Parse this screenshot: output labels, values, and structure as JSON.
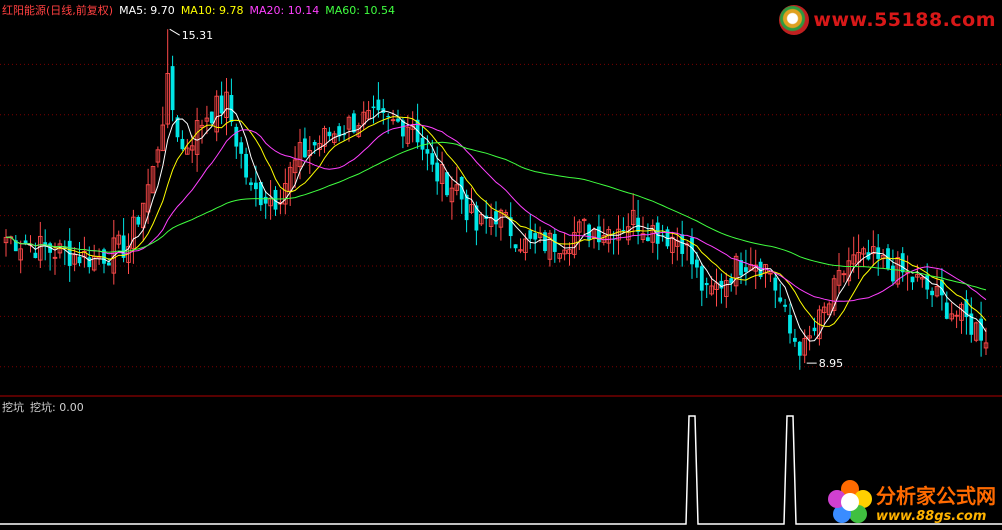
{
  "header": {
    "title": "红阳能源(日线,前复权)",
    "ma5": "MA5: 9.70",
    "ma10": "MA10: 9.78",
    "ma20": "MA20: 10.14",
    "ma60": "MA60: 10.54"
  },
  "sub_header": {
    "label": "挖坑",
    "value": "挖坑: 0.00"
  },
  "logos": {
    "top": "www.55188.com",
    "bottom_line1": "分析家公式网",
    "bottom_line2": "www.88gs.com"
  },
  "colors": {
    "up": "#ff4a4a",
    "down": "#00e5e5",
    "ma5": "#ffffff",
    "ma10": "#ffff00",
    "ma20": "#ff40ff",
    "ma60": "#40ff40",
    "title": "#ff4040",
    "text": "#d0d0d0",
    "grid": "#7a0000",
    "indicator": "#ffffff"
  },
  "chart_data": {
    "type": "candlestick",
    "price_range": [
      8.4,
      15.6
    ],
    "annotations": [
      {
        "label": "15.31",
        "price": 15.31,
        "kind": "high"
      },
      {
        "label": "8.95",
        "price": 8.95,
        "kind": "low"
      }
    ],
    "anchors": [
      {
        "i": 0,
        "p": 11.35
      },
      {
        "i": 9,
        "p": 11.1
      },
      {
        "i": 18,
        "p": 10.95
      },
      {
        "i": 25,
        "p": 11.2
      },
      {
        "i": 30,
        "p": 12.6
      },
      {
        "i": 33,
        "p": 14.2
      },
      {
        "i": 36,
        "p": 13.0
      },
      {
        "i": 41,
        "p": 13.7
      },
      {
        "i": 45,
        "p": 13.9
      },
      {
        "i": 50,
        "p": 12.2
      },
      {
        "i": 55,
        "p": 12.1
      },
      {
        "i": 60,
        "p": 12.9
      },
      {
        "i": 66,
        "p": 13.3
      },
      {
        "i": 72,
        "p": 13.6
      },
      {
        "i": 78,
        "p": 13.5
      },
      {
        "i": 83,
        "p": 13.55
      },
      {
        "i": 87,
        "p": 12.6
      },
      {
        "i": 92,
        "p": 12.3
      },
      {
        "i": 96,
        "p": 11.5
      },
      {
        "i": 100,
        "p": 11.8
      },
      {
        "i": 106,
        "p": 11.2
      },
      {
        "i": 112,
        "p": 11.25
      },
      {
        "i": 118,
        "p": 11.5
      },
      {
        "i": 123,
        "p": 11.5
      },
      {
        "i": 128,
        "p": 11.7
      },
      {
        "i": 133,
        "p": 11.45
      },
      {
        "i": 138,
        "p": 11.3
      },
      {
        "i": 143,
        "p": 10.2
      },
      {
        "i": 148,
        "p": 10.7
      },
      {
        "i": 152,
        "p": 11.0
      },
      {
        "i": 156,
        "p": 10.7
      },
      {
        "i": 160,
        "p": 9.5
      },
      {
        "i": 163,
        "p": 9.2
      },
      {
        "i": 168,
        "p": 10.1
      },
      {
        "i": 172,
        "p": 10.9
      },
      {
        "i": 177,
        "p": 10.9
      },
      {
        "i": 182,
        "p": 10.7
      },
      {
        "i": 186,
        "p": 10.5
      },
      {
        "i": 190,
        "p": 10.2
      },
      {
        "i": 195,
        "p": 9.8
      },
      {
        "i": 200,
        "p": 9.5
      }
    ],
    "indicator": {
      "name": "挖坑",
      "value": 0.0,
      "spikes": [
        {
          "i": 140,
          "value": 1
        },
        {
          "i": 160,
          "value": 1
        }
      ]
    }
  }
}
